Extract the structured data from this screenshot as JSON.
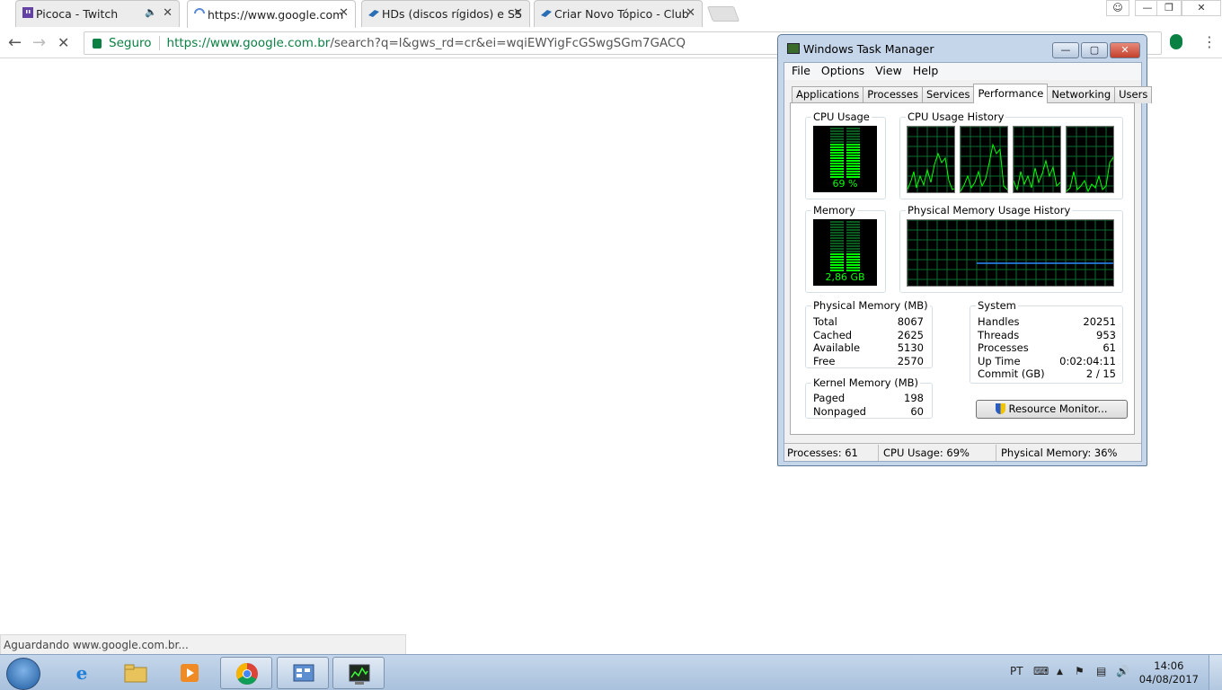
{
  "browser": {
    "tabs": [
      {
        "title": "Picoca - Twitch",
        "icon": "twitch-icon",
        "audio": true
      },
      {
        "title": "https://www.google.com",
        "icon": "loading-spinner-icon"
      },
      {
        "title": "HDs (discos rígidos) e SS",
        "icon": "forum-icon"
      },
      {
        "title": "Criar Novo Tópico - Club",
        "icon": "forum-icon"
      }
    ],
    "secure_label": "Seguro",
    "url_host": "https://www.google.com.br",
    "url_rest": "/search?q=l&gws_rd=cr&ei=wqiEWYigFcGSwgSGm7GACQ",
    "status_text": "Aguardando www.google.com.br..."
  },
  "taskmanager": {
    "title": "Windows Task Manager",
    "menu": [
      "File",
      "Options",
      "View",
      "Help"
    ],
    "tabs": [
      "Applications",
      "Processes",
      "Services",
      "Performance",
      "Networking",
      "Users"
    ],
    "active_tab": "Performance",
    "cpu_label": "CPU Usage",
    "cpu_value": "69 %",
    "cpu_fraction": 0.69,
    "cpu_history_label": "CPU Usage History",
    "memory_label": "Memory",
    "memory_value": "2,86 GB",
    "memory_fraction": 0.36,
    "mem_history_label": "Physical Memory Usage History",
    "physical_memory": {
      "title": "Physical Memory (MB)",
      "rows": [
        {
          "k": "Total",
          "v": "8067"
        },
        {
          "k": "Cached",
          "v": "2625"
        },
        {
          "k": "Available",
          "v": "5130"
        },
        {
          "k": "Free",
          "v": "2570"
        }
      ]
    },
    "kernel_memory": {
      "title": "Kernel Memory (MB)",
      "rows": [
        {
          "k": "Paged",
          "v": "198"
        },
        {
          "k": "Nonpaged",
          "v": "60"
        }
      ]
    },
    "system": {
      "title": "System",
      "rows": [
        {
          "k": "Handles",
          "v": "20251"
        },
        {
          "k": "Threads",
          "v": "953"
        },
        {
          "k": "Processes",
          "v": "61"
        },
        {
          "k": "Up Time",
          "v": "0:02:04:11"
        },
        {
          "k": "Commit (GB)",
          "v": "2 / 15"
        }
      ]
    },
    "resource_monitor_button": "Resource Monitor...",
    "status": {
      "processes": "Processes: 61",
      "cpu": "CPU Usage: 69%",
      "memory": "Physical Memory: 36%"
    }
  },
  "taskbar": {
    "language": "PT",
    "time": "14:06",
    "date": "04/08/2017",
    "apps": [
      "internet-explorer-icon",
      "file-explorer-icon",
      "media-player-icon",
      "chrome-icon",
      "control-panel-icon",
      "task-manager-icon"
    ]
  }
}
